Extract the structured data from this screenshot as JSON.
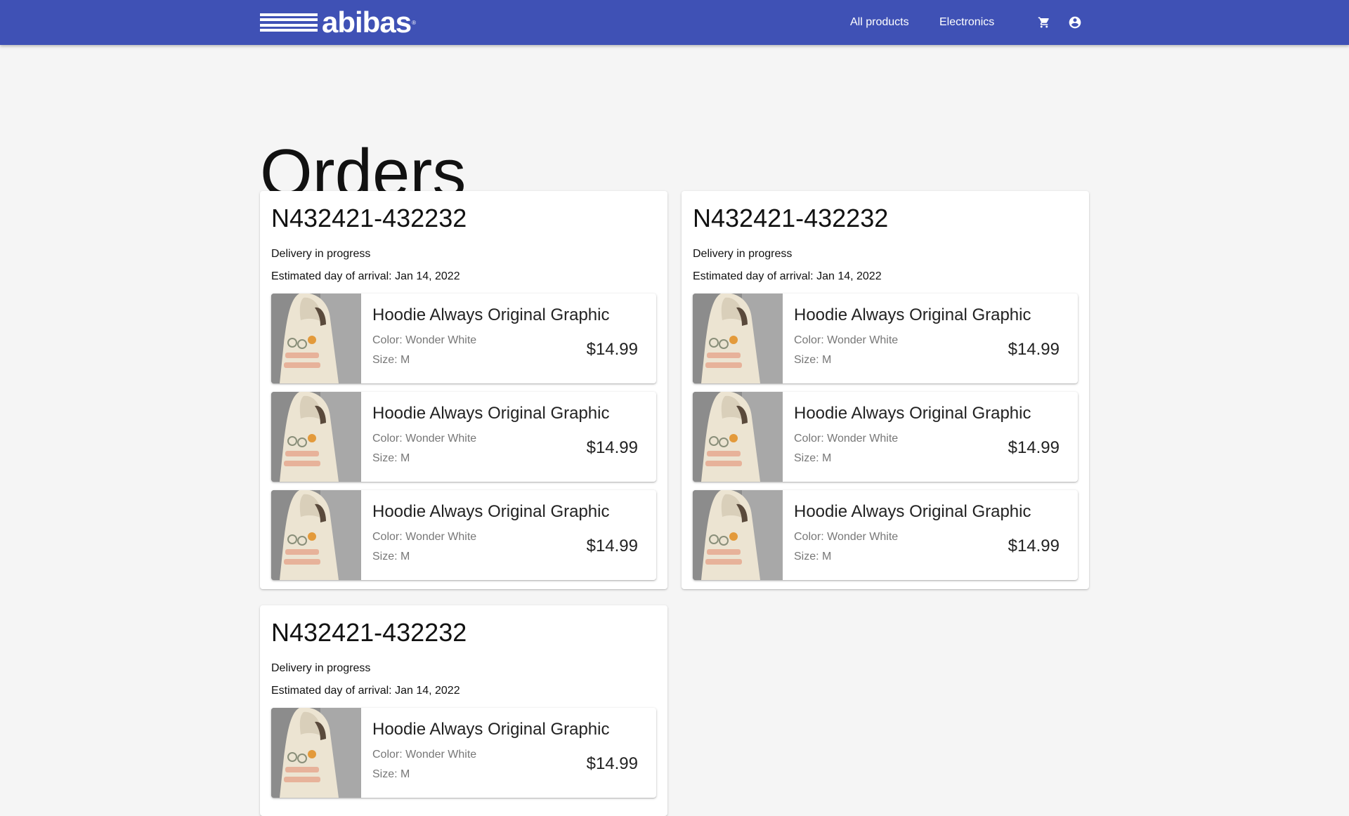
{
  "brand": {
    "name": "abibas",
    "mark": "®"
  },
  "nav": {
    "all_products": "All products",
    "electronics": "Electronics"
  },
  "icons": {
    "cart": "cart-icon",
    "account": "account-circle-icon"
  },
  "colors": {
    "appbar": "#3f51b5",
    "background": "#f5f5f5"
  },
  "page": {
    "title": "Orders"
  },
  "orders": [
    {
      "id": "N432421-432232",
      "status": "Delivery in progress",
      "eta": "Estimated day of arrival: Jan 14, 2022",
      "items": [
        {
          "name": "Hoodie Always Original Graphic",
          "color": "Color: Wonder White",
          "size": "Size: M",
          "price": "$14.99"
        },
        {
          "name": "Hoodie Always Original Graphic",
          "color": "Color: Wonder White",
          "size": "Size: M",
          "price": "$14.99"
        },
        {
          "name": "Hoodie Always Original Graphic",
          "color": "Color: Wonder White",
          "size": "Size: M",
          "price": "$14.99"
        }
      ]
    },
    {
      "id": "N432421-432232",
      "status": "Delivery in progress",
      "eta": "Estimated day of arrival: Jan 14, 2022",
      "items": [
        {
          "name": "Hoodie Always Original Graphic",
          "color": "Color: Wonder White",
          "size": "Size: M",
          "price": "$14.99"
        },
        {
          "name": "Hoodie Always Original Graphic",
          "color": "Color: Wonder White",
          "size": "Size: M",
          "price": "$14.99"
        },
        {
          "name": "Hoodie Always Original Graphic",
          "color": "Color: Wonder White",
          "size": "Size: M",
          "price": "$14.99"
        }
      ]
    },
    {
      "id": "N432421-432232",
      "status": "Delivery in progress",
      "eta": "Estimated day of arrival: Jan 14, 2022",
      "items": [
        {
          "name": "Hoodie Always Original Graphic",
          "color": "Color: Wonder White",
          "size": "Size: M",
          "price": "$14.99"
        }
      ]
    }
  ]
}
